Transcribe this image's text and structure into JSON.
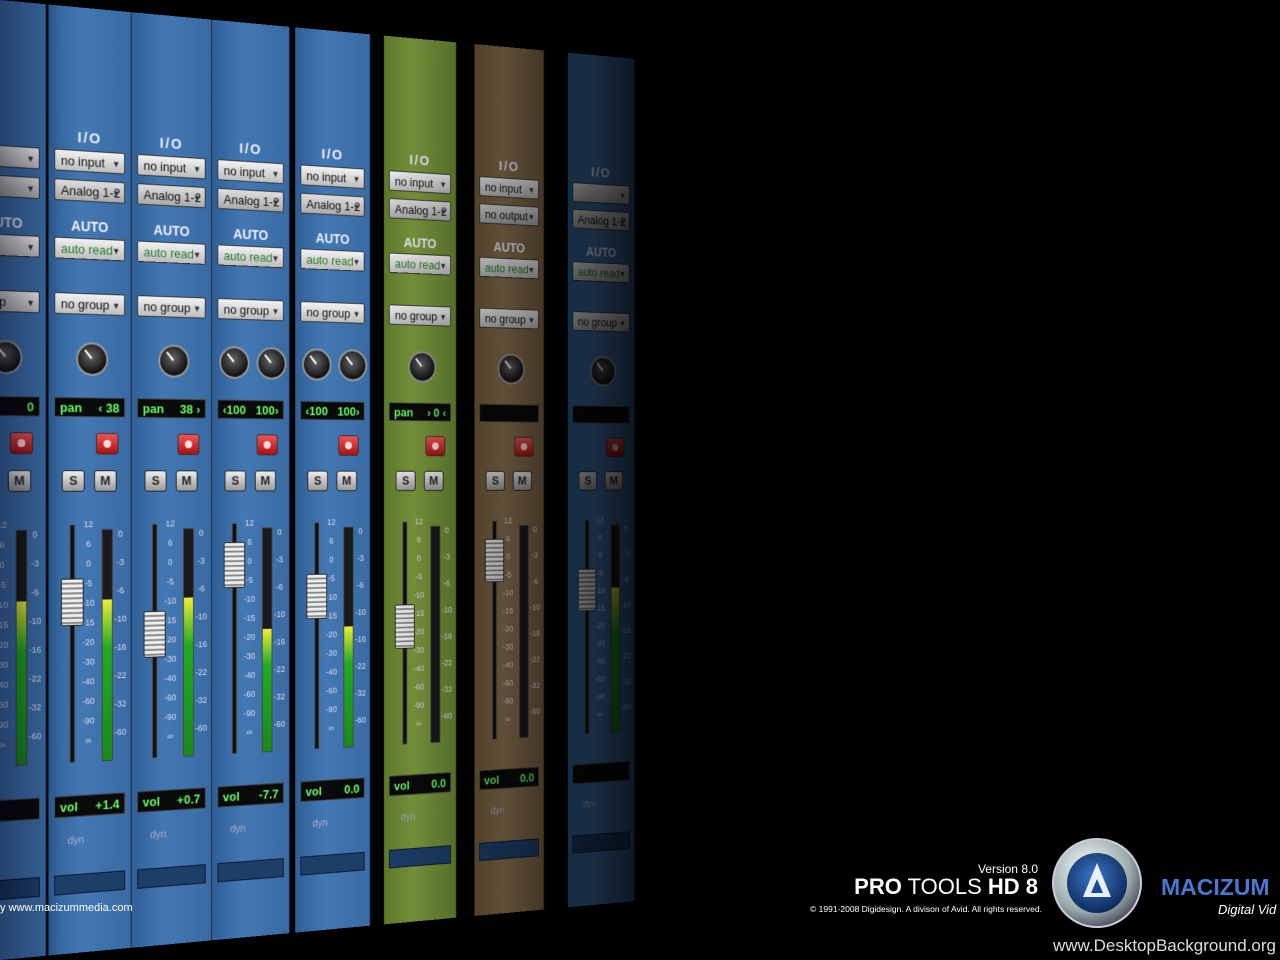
{
  "mixer": {
    "strips": [
      {
        "io": "",
        "input": "",
        "output": "",
        "auto": "AUTO",
        "auto_mode": "read",
        "group": "group",
        "pan_label": "",
        "pan_value": "0",
        "vol_label": "",
        "vol_value": "",
        "theme": "blue"
      },
      {
        "io": "I/O",
        "input": "no input",
        "output": "Analog 1-2",
        "auto": "AUTO",
        "auto_mode": "auto read",
        "group": "no group",
        "pan_label": "pan",
        "pan_value": "‹ 38",
        "vol_label": "vol",
        "vol_value": "+1.4",
        "theme": "blue"
      },
      {
        "io": "I/O",
        "input": "no input",
        "output": "Analog 1-2",
        "auto": "AUTO",
        "auto_mode": "auto read",
        "group": "no group",
        "pan_label": "pan",
        "pan_value": "38 ›",
        "vol_label": "vol",
        "vol_value": "+0.7",
        "theme": "blue"
      },
      {
        "io": "I/O",
        "input": "no input",
        "output": "Analog 1-2",
        "auto": "AUTO",
        "auto_mode": "auto read",
        "group": "no group",
        "pan_label": "‹100",
        "pan_value": "100›",
        "vol_label": "vol",
        "vol_value": "-7.7",
        "theme": "blue"
      },
      {
        "io": "I/O",
        "input": "no input",
        "output": "Analog 1-2",
        "auto": "AUTO",
        "auto_mode": "auto read",
        "group": "no group",
        "pan_label": "‹100",
        "pan_value": "100›",
        "vol_label": "vol",
        "vol_value": "0.0",
        "theme": "blue"
      },
      {
        "io": "I/O",
        "input": "no input",
        "output": "Analog 1-2",
        "auto": "AUTO",
        "auto_mode": "auto read",
        "group": "no group",
        "pan_label": "pan",
        "pan_value": "› 0 ‹",
        "vol_label": "vol",
        "vol_value": "0.0",
        "theme": "green"
      },
      {
        "io": "I/O",
        "input": "no input",
        "output": "no output",
        "auto": "AUTO",
        "auto_mode": "auto read",
        "group": "no group",
        "pan_label": "",
        "pan_value": "",
        "vol_label": "vol",
        "vol_value": "0.0",
        "theme": "tan"
      },
      {
        "io": "I/O",
        "input": "",
        "output": "Analog 1-2",
        "auto": "AUTO",
        "auto_mode": "auto read",
        "group": "no group",
        "pan_label": "",
        "pan_value": "",
        "vol_label": "",
        "vol_value": "",
        "theme": "blue"
      }
    ],
    "solo_label": "S",
    "mute_label": "M",
    "dyn_label": "dyn",
    "scale_fader": [
      "12",
      "6",
      "0",
      "-5",
      "-10",
      "-15",
      "-20",
      "-30",
      "-40",
      "-60",
      "-90",
      "∞"
    ],
    "scale_meter": [
      "0",
      "-3",
      "-6",
      "-10",
      "-16",
      "-22",
      "-32",
      "-60"
    ]
  },
  "footer": {
    "url_left": "y www.macizummedia.com",
    "version": "Version 8.0",
    "product_bold": "PRO",
    "product_rest": " TOOLS ",
    "product_hd": "HD 8",
    "copyright": "© 1991-2008 Digidesign. A divison of Avid. All rights reserved.",
    "brand": "MACIZUM",
    "brand_sub": "Digital Vid",
    "site": "www.DesktopBackground.org"
  }
}
